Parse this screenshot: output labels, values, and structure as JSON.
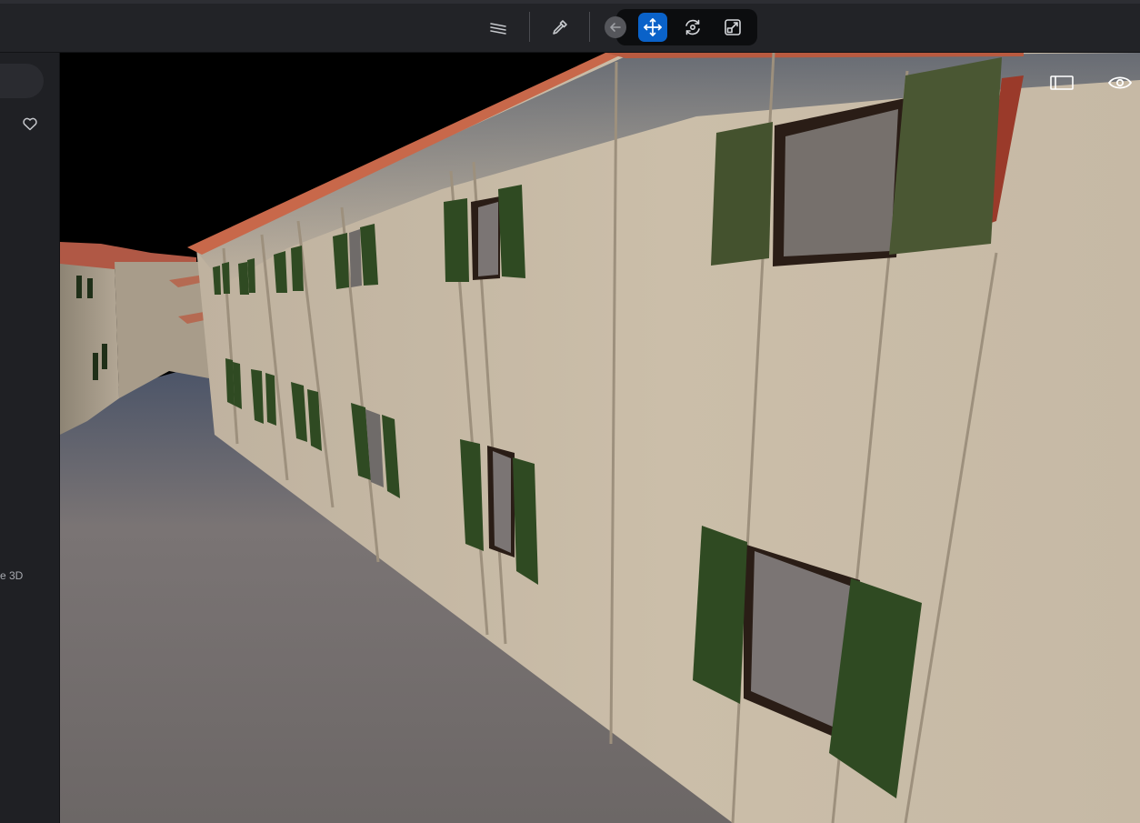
{
  "toolbar": {
    "tools": [
      "layers-icon",
      "eyedropper-icon",
      "back-arrow-icon",
      "move-icon",
      "rotate-icon",
      "scale-icon"
    ],
    "active_tool": "move-icon",
    "accent_color": "#0a62c9"
  },
  "sidebar": {
    "caption": "e 3D",
    "icons": [
      "heart-icon"
    ]
  },
  "viewport": {
    "overlay_icons": [
      "panel-toggle-icon",
      "eye-icon"
    ],
    "scene_colors": {
      "wall": "#cbbda8",
      "shutter": "#2f4a22",
      "roof_trim": "#c8684a",
      "ground": "#7b7575",
      "sky": "#000000"
    }
  }
}
